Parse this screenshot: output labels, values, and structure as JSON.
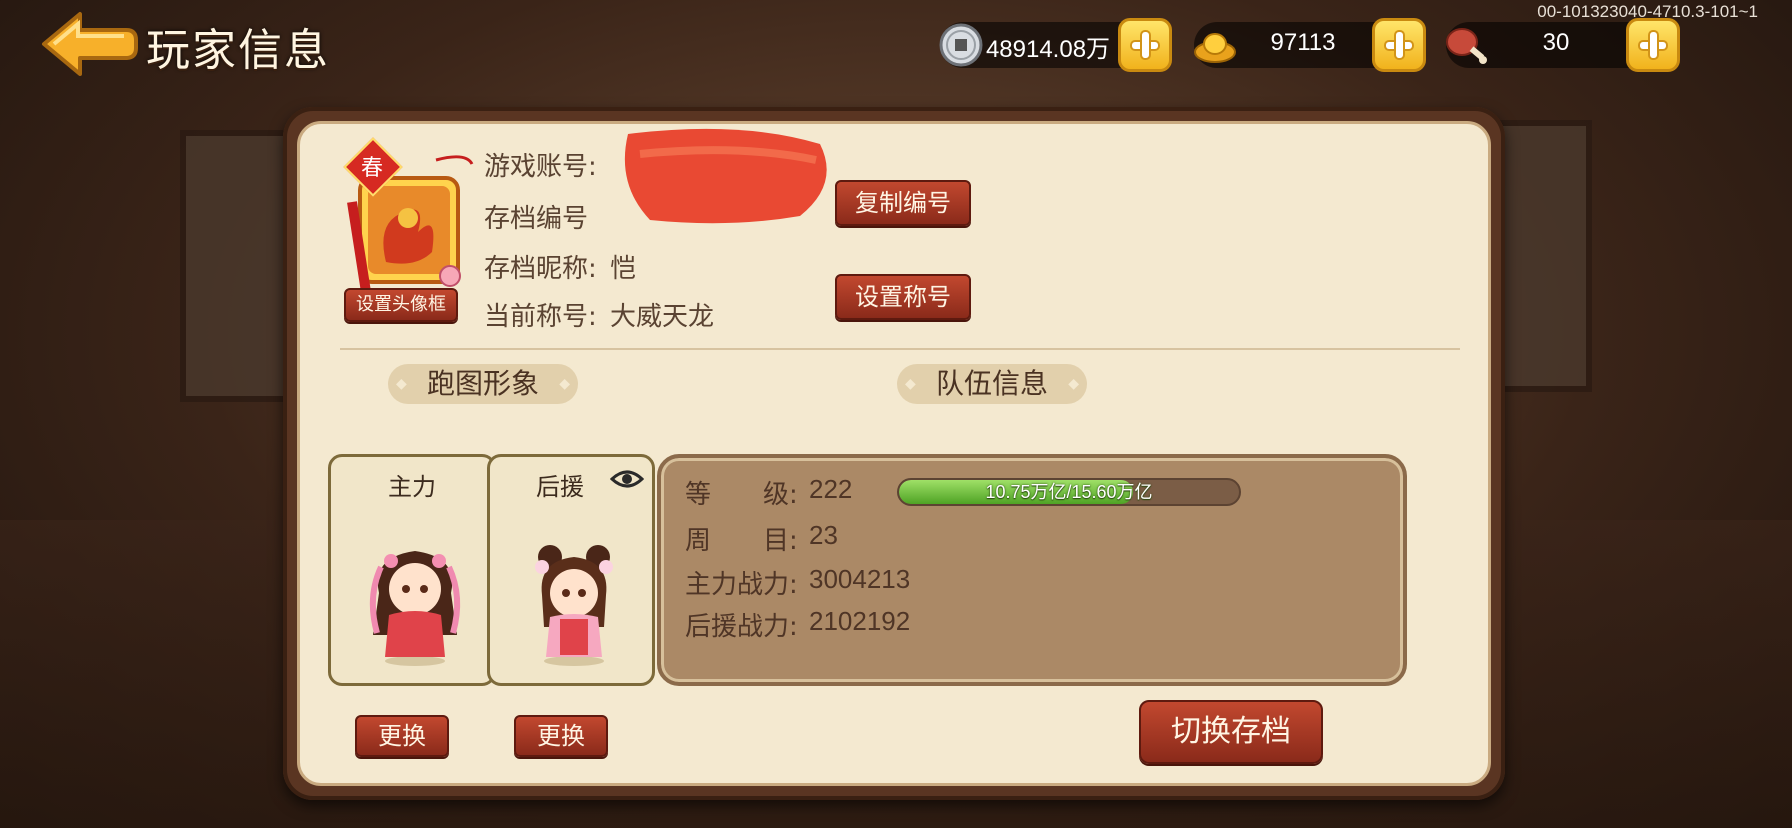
{
  "header": {
    "title": "玩家信息",
    "version": "00-101323040-4710.3-101~1"
  },
  "resources": {
    "silver": "48914.08万",
    "gold": "97113",
    "stamina": "30"
  },
  "profile": {
    "account_label": "游戏账号:",
    "save_id_label": "存档编号",
    "nickname_label": "存档昵称:",
    "nickname_value": "恺",
    "title_label": "当前称号:",
    "title_value": "大威天龙",
    "copy_id_button": "复制编号",
    "set_title_button": "设置称号",
    "set_frame_button": "设置头像框",
    "avatar_badge": "春"
  },
  "appearance": {
    "section_label": "跑图形象",
    "main_label": "主力",
    "support_label": "后援",
    "change_button": "更换"
  },
  "team": {
    "section_label": "队伍信息",
    "level_label": "等　　级:",
    "level_value": "222",
    "xp_text": "10.75万亿/15.60万亿",
    "xp_progress": 0.689,
    "cycle_label": "周　　目:",
    "cycle_value": "23",
    "main_power_label": "主力战力:",
    "main_power_value": "3004213",
    "support_power_label": "后援战力:",
    "support_power_value": "2102192"
  },
  "switch_save_button": "切换存档",
  "colors": {
    "panel_bg": "#f4e9d0",
    "button_red": "#a8371f",
    "xp_green": "#6cc23a",
    "team_box": "#ab8966"
  }
}
